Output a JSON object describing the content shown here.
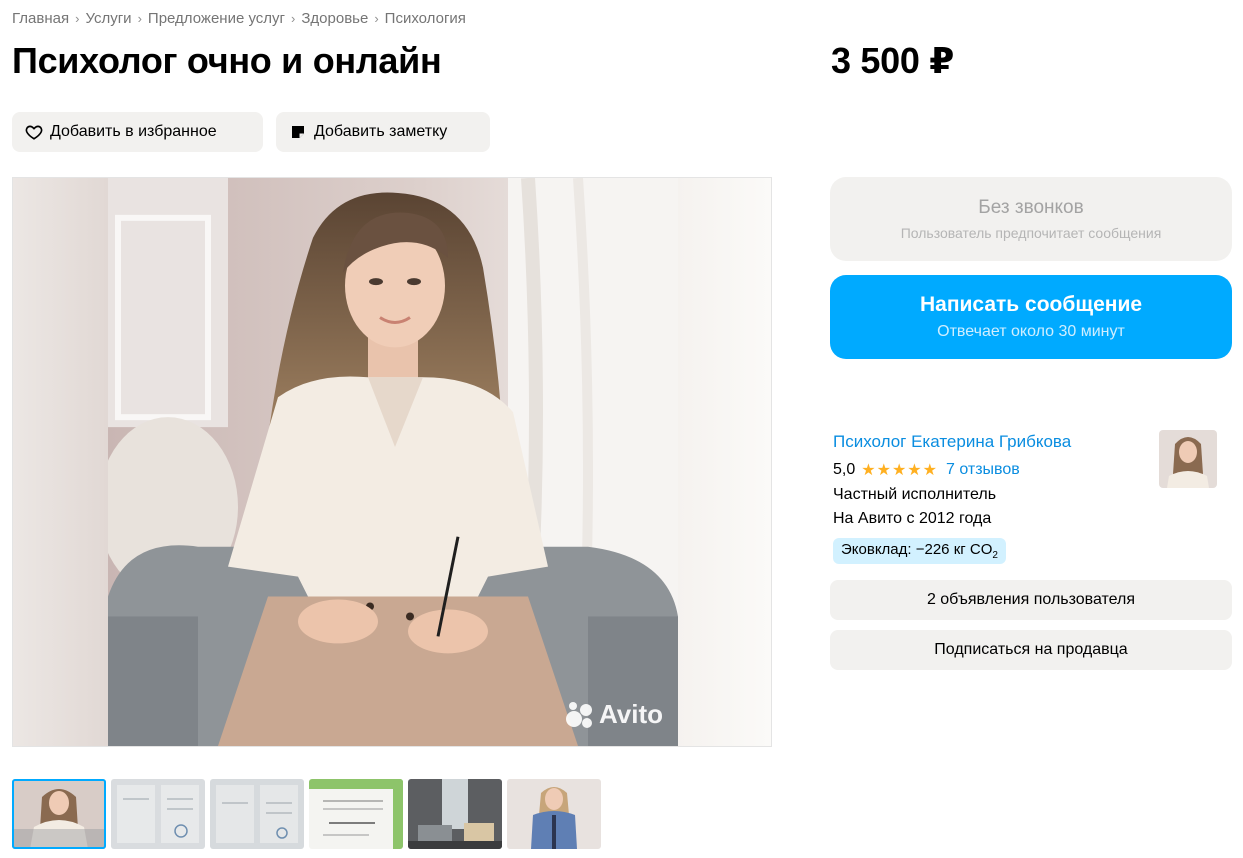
{
  "breadcrumb": [
    "Главная",
    "Услуги",
    "Предложение услуг",
    "Здоровье",
    "Психология"
  ],
  "title": "Психолог очно и онлайн",
  "price": "3 500 ₽",
  "actions": {
    "favorite_label": "Добавить в избранное",
    "note_label": "Добавить заметку"
  },
  "gallery": {
    "watermark": "Avito",
    "thumbnails": [
      "portrait",
      "diploma",
      "diploma",
      "certificate",
      "office",
      "portrait-standing"
    ],
    "active_index": 0
  },
  "contact": {
    "no_calls_title": "Без звонков",
    "no_calls_subtitle": "Пользователь предпочитает сообщения",
    "message_title": "Написать сообщение",
    "message_subtitle": "Отвечает около 30 минут"
  },
  "seller": {
    "name": "Психолог Екатерина Грибкова",
    "rating": "5,0",
    "stars": "★★★★★",
    "reviews": "7 отзывов",
    "type": "Частный исполнитель",
    "since": "На Авито с 2012 года",
    "eco_label": "Эковклад: −226 кг CO",
    "eco_sub": "2",
    "ads_button": "2 объявления пользователя",
    "subscribe_button": "Подписаться на продавца"
  },
  "colors": {
    "accent": "#00aaff",
    "link": "#0a8de0",
    "button_bg": "#f2f1ef",
    "star": "#ffb021",
    "eco_bg": "#d2f1ff"
  },
  "icons": [
    "heart-icon",
    "note-icon",
    "chevron-right-icon",
    "star-icon"
  ]
}
